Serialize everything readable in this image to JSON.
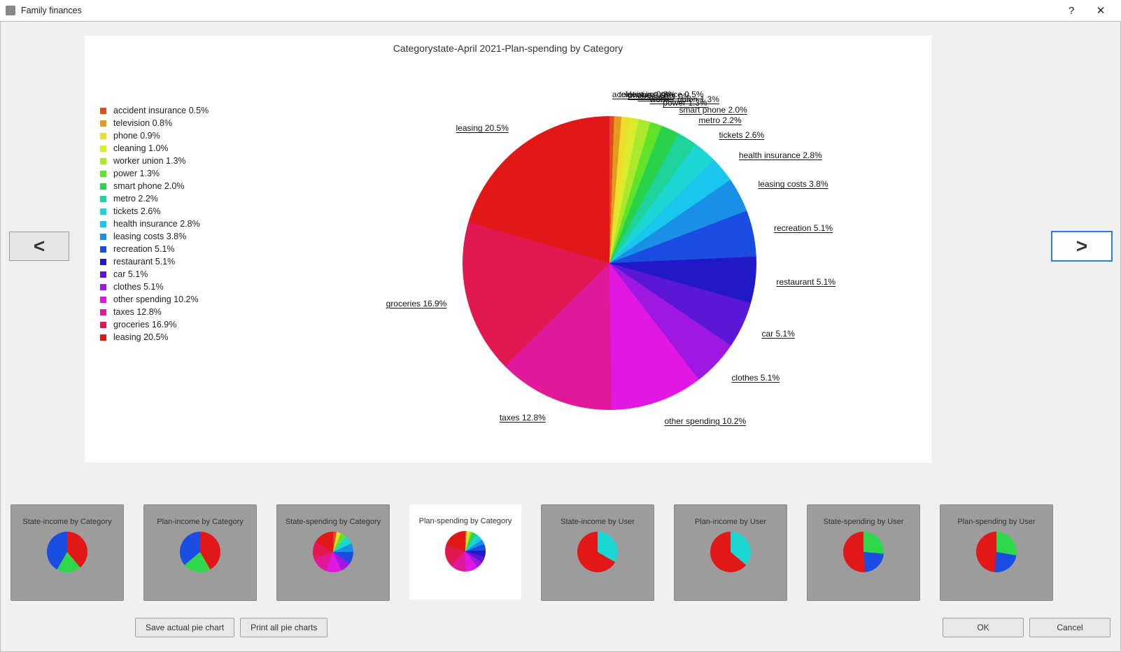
{
  "window": {
    "title": "Family finances",
    "help_glyph": "?",
    "close_glyph": "✕"
  },
  "nav": {
    "prev": "<",
    "next": ">"
  },
  "buttons": {
    "save": "Save actual pie chart",
    "print": "Print all pie charts",
    "ok": "OK",
    "cancel": "Cancel"
  },
  "chart_data": {
    "type": "pie",
    "title": "Categorystate-April 2021-Plan-spending by Category",
    "series": [
      {
        "name": "accident insurance",
        "value": 0.5,
        "color": "#e24a1f"
      },
      {
        "name": "television",
        "value": 0.8,
        "color": "#e29b1f"
      },
      {
        "name": "phone",
        "value": 0.9,
        "color": "#eedc2a"
      },
      {
        "name": "cleaning",
        "value": 1.0,
        "color": "#d9ec2b"
      },
      {
        "name": "worker union",
        "value": 1.3,
        "color": "#a9e82a"
      },
      {
        "name": "power",
        "value": 1.3,
        "color": "#5fe22a"
      },
      {
        "name": "smart phone",
        "value": 2.0,
        "color": "#28d24a"
      },
      {
        "name": "metro",
        "value": 2.2,
        "color": "#1ed39b"
      },
      {
        "name": "tickets",
        "value": 2.6,
        "color": "#1bd6d2"
      },
      {
        "name": "health insurance",
        "value": 2.8,
        "color": "#19c7ee"
      },
      {
        "name": "leasing costs",
        "value": 3.8,
        "color": "#1a8fe6"
      },
      {
        "name": "recreation",
        "value": 5.1,
        "color": "#1a4de2"
      },
      {
        "name": "restaurant",
        "value": 5.1,
        "color": "#2118c7"
      },
      {
        "name": "car",
        "value": 5.1,
        "color": "#5a18d6"
      },
      {
        "name": "clothes",
        "value": 5.1,
        "color": "#9e18e2"
      },
      {
        "name": "other spending",
        "value": 10.2,
        "color": "#e218e2"
      },
      {
        "name": "taxes",
        "value": 12.8,
        "color": "#e2189a"
      },
      {
        "name": "groceries",
        "value": 16.9,
        "color": "#e21852"
      },
      {
        "name": "leasing",
        "value": 20.5,
        "color": "#e21818"
      }
    ]
  },
  "thumbnails": [
    {
      "label": "State-income by Category",
      "gradient": "conic-gradient(#e21818 0 140deg,#2fd84a 140deg 210deg,#1a4de2 210deg 360deg)"
    },
    {
      "label": "Plan-income by Category",
      "gradient": "conic-gradient(#e21818 0 150deg,#2fd84a 150deg 230deg,#1a4de2 230deg 360deg)"
    },
    {
      "label": "State-spending by Category",
      "gradient": "conic-gradient(#e24a1f 0 10deg,#eedc2a 10deg 22deg,#5fe22a 22deg 40deg,#1bd6d2 40deg 65deg,#1a8fe6 65deg 90deg,#1a4de2 90deg 125deg,#9e18e2 125deg 155deg,#e218e2 155deg 200deg,#e2189a 200deg 250deg,#e21852 250deg 300deg,#e21818 300deg 360deg)"
    },
    {
      "label": "Plan-spending by Category",
      "active": true,
      "gradient": "USE_MAIN"
    },
    {
      "label": "State-income by User",
      "gradient": "conic-gradient(#1bd6d2 0 120deg,#e21818 120deg 360deg)"
    },
    {
      "label": "Plan-income by User",
      "gradient": "conic-gradient(#1bd6d2 0 130deg,#e21818 130deg 360deg)"
    },
    {
      "label": "State-spending by User",
      "gradient": "conic-gradient(#2fd84a 0 95deg,#1a4de2 95deg 175deg,#e21818 175deg 360deg)"
    },
    {
      "label": "Plan-spending by User",
      "gradient": "conic-gradient(#2fd84a 0 100deg,#1a4de2 100deg 185deg,#e21818 185deg 360deg)"
    }
  ]
}
